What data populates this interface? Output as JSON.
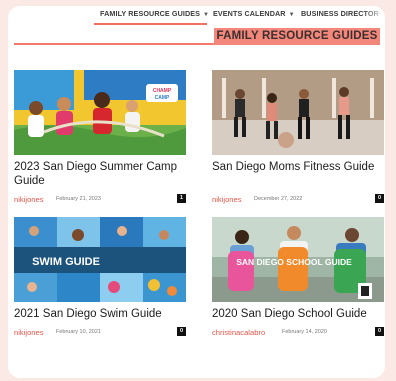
{
  "nav": {
    "items": [
      {
        "label": "FAMILY RESOURCE GUIDES",
        "chevron": "chevron-down-icon"
      },
      {
        "label": "EVENTS CALENDAR",
        "chevron": "chevron-down-icon"
      },
      {
        "label": "BUSINESS DIRECTOR·"
      }
    ]
  },
  "section": {
    "title": "FAMILY RESOURCE GUIDES"
  },
  "colors": {
    "accent": "#f26e5f",
    "author": "#e4574b",
    "tag": "#f4877b"
  },
  "posts": [
    {
      "title": "2023 San Diego Summer Camp Guide",
      "author": "nikijones",
      "date": "February 21, 2023",
      "comments": "1",
      "badge": "CHAMP CAMP"
    },
    {
      "title": "San Diego Moms Fitness Guide",
      "author": "nikijones",
      "date": "December 27, 2022",
      "comments": "0"
    },
    {
      "title": "2021 San Diego Swim Guide",
      "author": "nikijones",
      "date": "February 10, 2021",
      "comments": "0",
      "overlay": "SWIM GUIDE"
    },
    {
      "title": "2020 San Diego School Guide",
      "author": "christinacalabro",
      "date": "February 14, 2020",
      "comments": "0",
      "overlay": "SAN DIEGO SCHOOL GUIDE"
    }
  ]
}
